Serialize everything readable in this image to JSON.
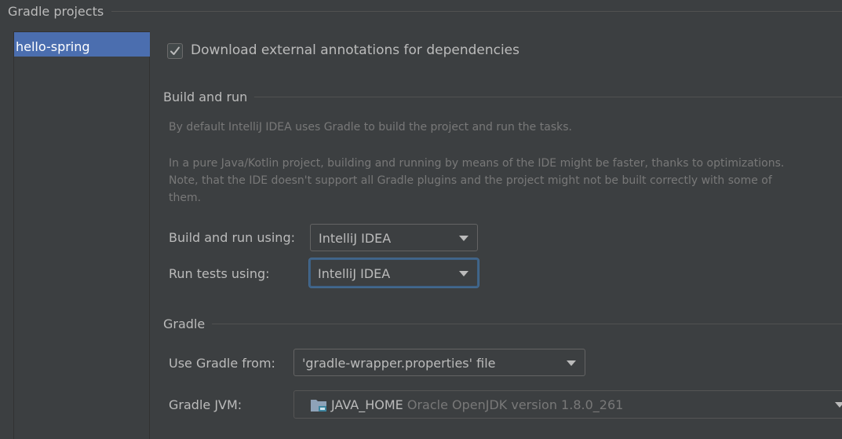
{
  "title": "Gradle projects",
  "projects": [
    {
      "label": "hello-spring",
      "selected": true
    }
  ],
  "options": {
    "download_annotations": {
      "label": "Download external annotations for dependencies",
      "checked": true
    }
  },
  "build_and_run": {
    "title": "Build and run",
    "hint_line1": "By default IntelliJ IDEA uses Gradle to build the project and run the tasks.",
    "hint_line2": "In a pure Java/Kotlin project, building and running by means of the IDE might be faster, thanks to optimizations.",
    "hint_line3": "Note, that the IDE doesn't support all Gradle plugins and the project might not be built correctly with some of",
    "hint_line4": "them.",
    "build_label": "Build and run using:",
    "build_value": "IntelliJ IDEA",
    "tests_label": "Run tests using:",
    "tests_value": "IntelliJ IDEA"
  },
  "gradle": {
    "title": "Gradle",
    "use_from_label": "Use Gradle from:",
    "use_from_value": "'gradle-wrapper.properties' file",
    "jvm_label": "Gradle JVM:",
    "jvm_name": "JAVA_HOME",
    "jvm_desc": "Oracle OpenJDK version 1.8.0_261",
    "jvm_icon": "folder-icon"
  },
  "colors": {
    "background": "#3c3f41",
    "selection": "#4b6eaf",
    "focus_border": "#3d6185",
    "text": "#bbbbbb",
    "hint_text": "#787878"
  }
}
